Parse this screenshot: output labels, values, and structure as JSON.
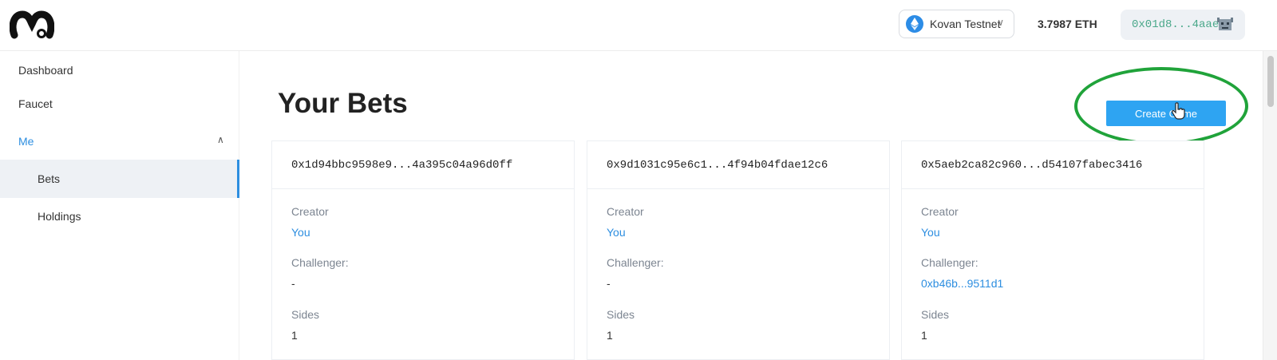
{
  "header": {
    "network": "Kovan Testnet",
    "balance": "3.7987 ETH",
    "account": "0x01d8...4aae86",
    "icons": {
      "logo": "brand-logo",
      "network": "ethereum-icon",
      "dropdown": "chevron-down-icon",
      "avatar": "avatar-icon"
    }
  },
  "sidebar": {
    "items": [
      {
        "label": "Dashboard"
      },
      {
        "label": "Faucet"
      },
      {
        "label": "Me"
      },
      {
        "label": "Bets"
      },
      {
        "label": "Holdings"
      }
    ]
  },
  "main": {
    "title": "Your Bets",
    "create_button": "Create Game",
    "cards": [
      {
        "id": "0x1d94bbc9598e9...4a395c04a96d0ff",
        "creator_label": "Creator",
        "creator": "You",
        "challenger_label": "Challenger:",
        "challenger": "-",
        "sides_label": "Sides",
        "sides": "1"
      },
      {
        "id": "0x9d1031c95e6c1...4f94b04fdae12c6",
        "creator_label": "Creator",
        "creator": "You",
        "challenger_label": "Challenger:",
        "challenger": "-",
        "sides_label": "Sides",
        "sides": "1"
      },
      {
        "id": "0x5aeb2ca82c960...d54107fabec3416",
        "creator_label": "Creator",
        "creator": "You",
        "challenger_label": "Challenger:",
        "challenger": "0xb46b...9511d1",
        "sides_label": "Sides",
        "sides": "1"
      }
    ]
  },
  "colors": {
    "accent": "#2d8ee0",
    "button": "#2ea4f2",
    "annotation": "#20a33a"
  }
}
